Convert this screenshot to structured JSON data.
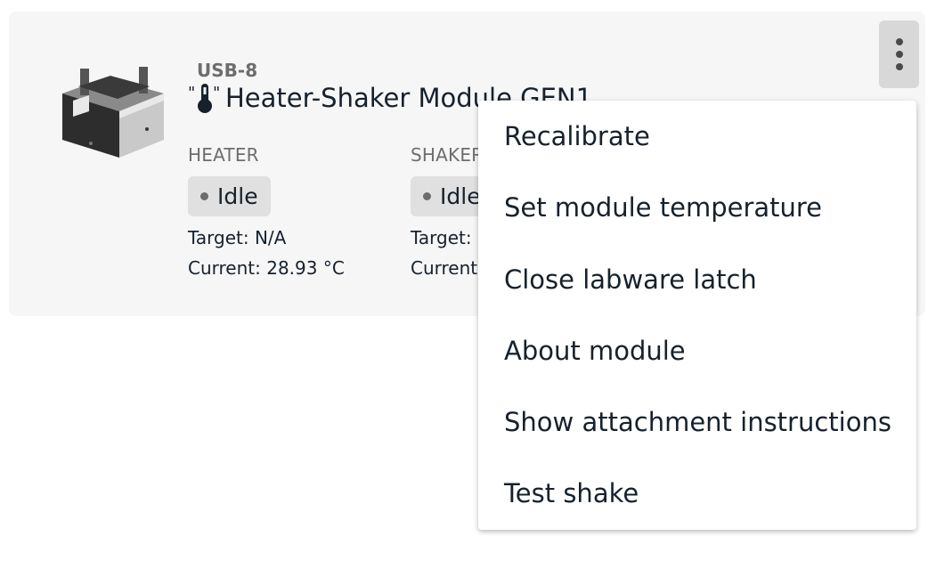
{
  "module": {
    "port": "USB-8",
    "icon": "thermometer-icon",
    "title": "Heater-Shaker Module GEN1",
    "heater": {
      "label": "HEATER",
      "status": "Idle",
      "target": "Target: N/A",
      "current": "Current: 28.93 °C"
    },
    "shaker": {
      "label": "SHAKER",
      "status": "Idle",
      "target": "Target:",
      "current": "Current"
    }
  },
  "overflow_menu": {
    "icon": "kebab-menu-icon",
    "items": [
      "Recalibrate",
      "Set module temperature",
      "Close labware latch",
      "About module",
      "Show attachment instructions",
      "Test shake"
    ]
  },
  "colors": {
    "card_bg": "#f6f6f6",
    "pill_bg": "#e0e0e0",
    "text": "#16212d",
    "muted": "#6d6d6d"
  }
}
